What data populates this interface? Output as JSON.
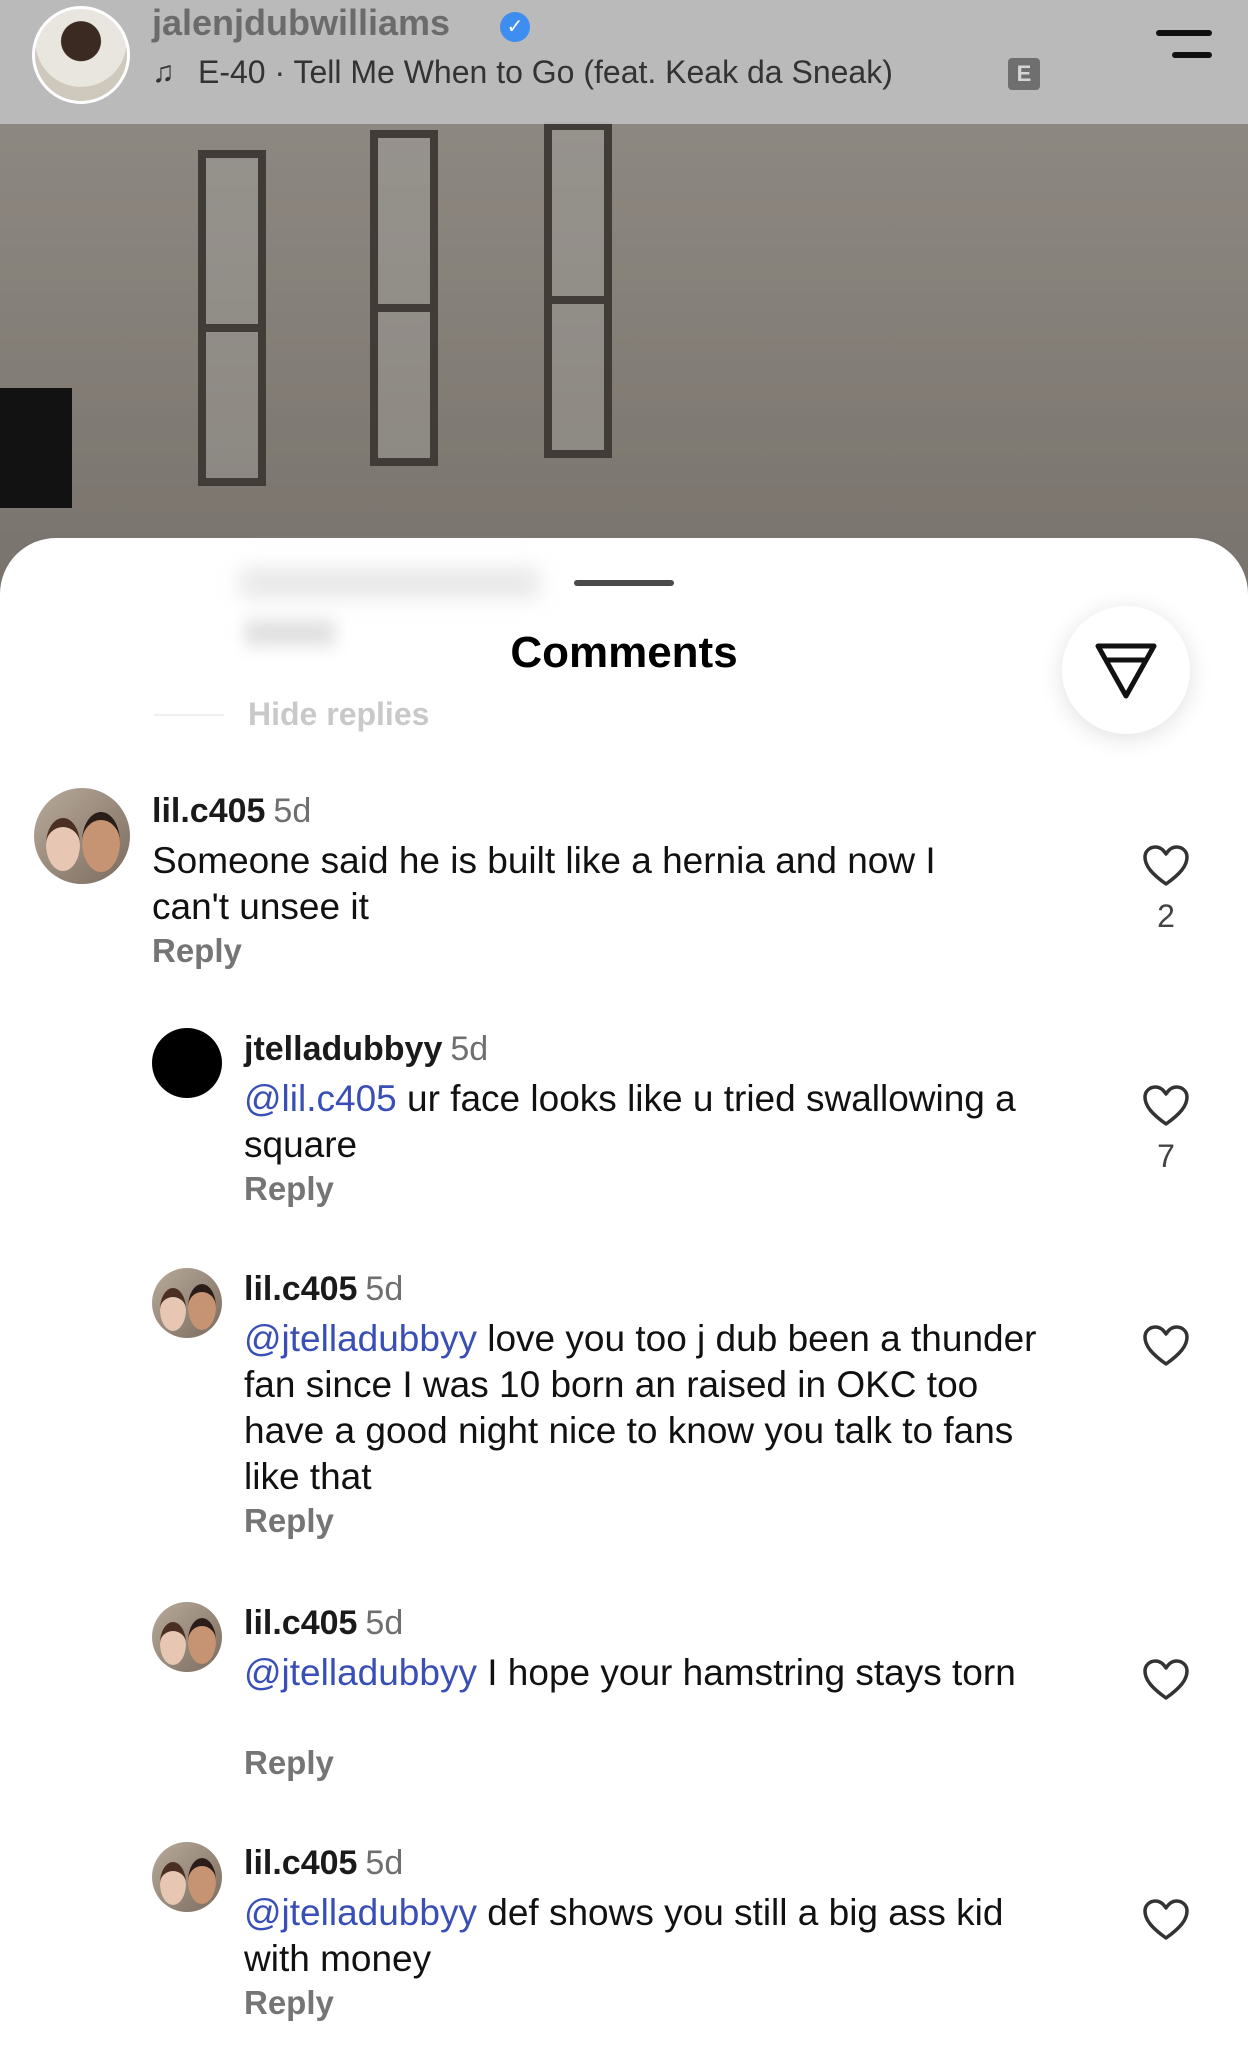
{
  "header": {
    "username": "jalenjdubwilliams",
    "song": "E-40 · Tell Me When to Go (feat. Keak da Sneak)",
    "explicit_label": "E",
    "verified_icon": "verified-badge-icon",
    "music_icon": "music-note-icon",
    "menu_icon": "menu-icon"
  },
  "sheet": {
    "title": "Comments",
    "hide_replies": "Hide replies",
    "filter_icon": "filter-icon"
  },
  "comments": [
    {
      "user": "lil.c405",
      "time": "5d",
      "mention": "",
      "text": "Someone said he is built like a hernia and now I can't unsee it",
      "reply": "Reply",
      "likes": "2"
    },
    {
      "user": "jtelladubbyy",
      "time": "5d",
      "mention": "@lil.c405",
      "text": " ur face looks like u tried swallowing a square",
      "reply": "Reply",
      "likes": "7"
    },
    {
      "user": "lil.c405",
      "time": "5d",
      "mention": "@jtelladubbyy",
      "text": " love you too j dub been a thunder fan since I was 10 born an raised in OKC too have a good night nice to know you talk to fans like that",
      "reply": "Reply",
      "likes": ""
    },
    {
      "user": "lil.c405",
      "time": "5d",
      "mention": "@jtelladubbyy",
      "text": " I hope your hamstring stays torn",
      "reply": "Reply",
      "likes": ""
    },
    {
      "user": "lil.c405",
      "time": "5d",
      "mention": "@jtelladubbyy",
      "text": " def shows you still a big ass kid with money",
      "reply": "Reply",
      "likes": ""
    }
  ]
}
